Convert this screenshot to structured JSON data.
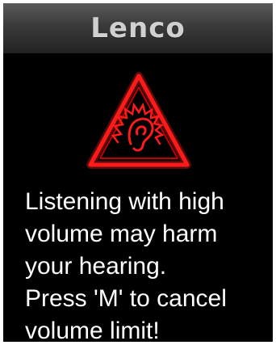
{
  "header": {
    "brand": "Lenco"
  },
  "icons": {
    "warning": "hearing-warning-icon"
  },
  "colors": {
    "warning_red": "#ff1a1a",
    "background": "#000000",
    "text": "#ffffff"
  },
  "message": {
    "lines": [
      "Listening with high",
      "volume may harm",
      "your hearing.",
      "Press 'M' to cancel",
      "volume limit!"
    ]
  }
}
